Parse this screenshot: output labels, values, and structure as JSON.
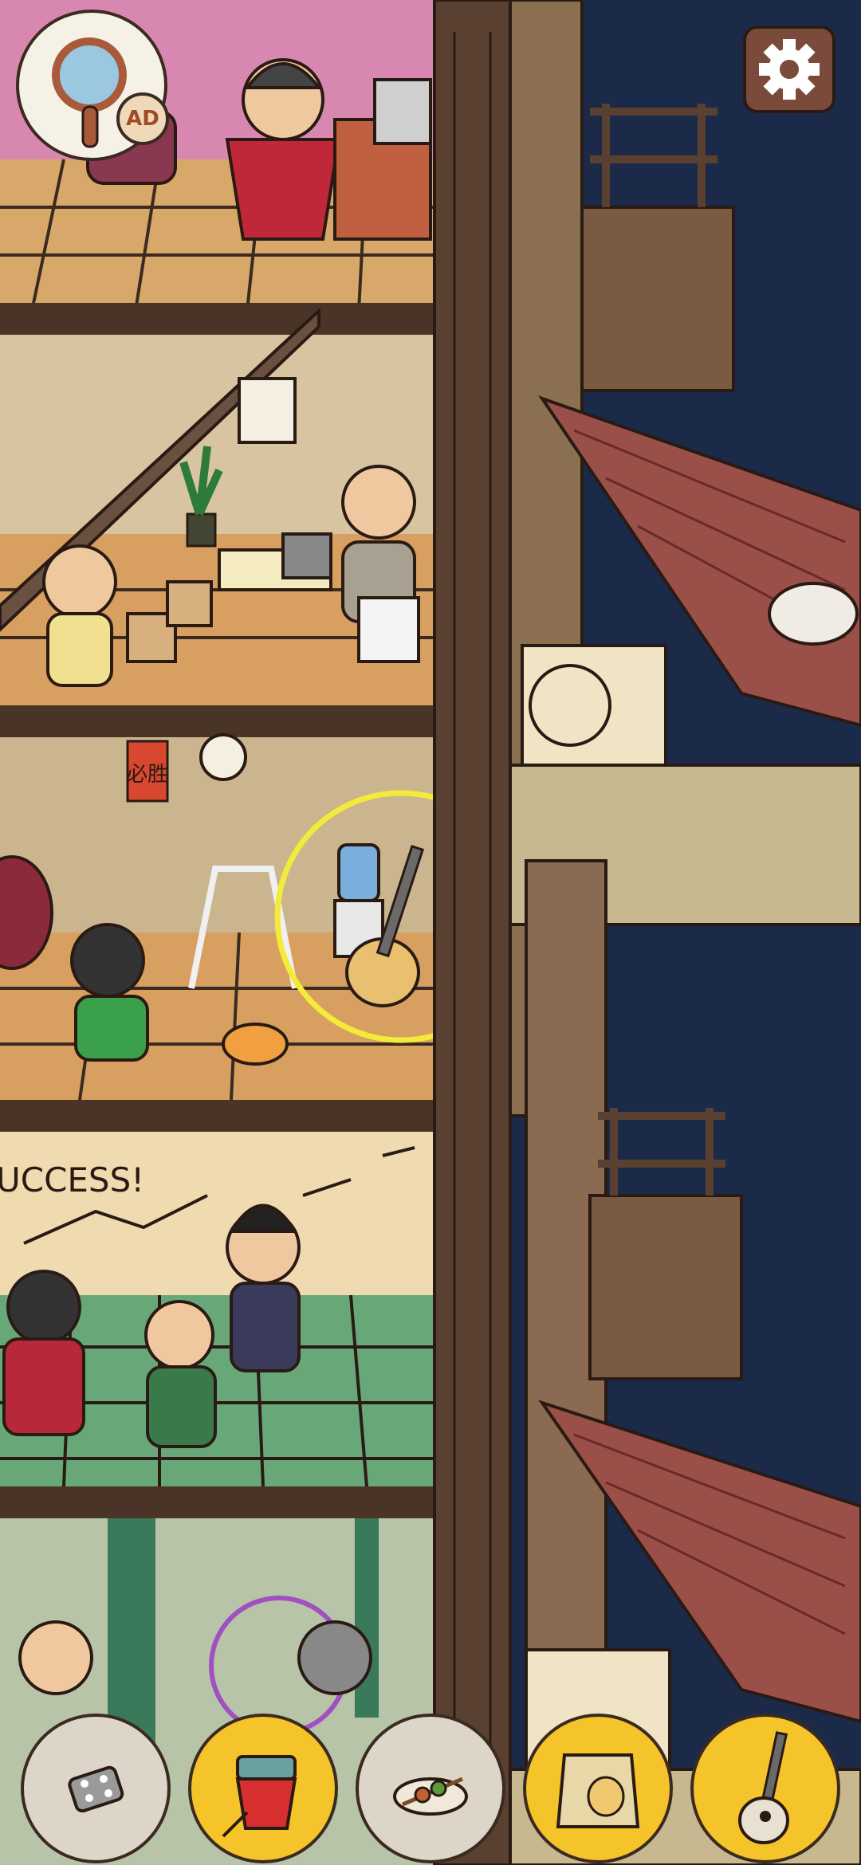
{
  "game": {
    "hint_button": {
      "ad_label": "AD"
    },
    "poster_text": "UCCESS!",
    "sign_text": "必胜",
    "highlighted_object": "guitar"
  },
  "inventory": {
    "items": [
      {
        "name": "dice-tile",
        "found": false
      },
      {
        "name": "noodle-cup",
        "found": true
      },
      {
        "name": "skewer-plate",
        "found": false
      },
      {
        "name": "dog-food-bag",
        "found": true
      },
      {
        "name": "guitar",
        "found": true
      }
    ]
  },
  "colors": {
    "night_sky": "#1c2a4a",
    "found_slot": "#f5c32a",
    "empty_slot": "#dcd5c8",
    "highlight_ring": "#f3ea3a"
  }
}
